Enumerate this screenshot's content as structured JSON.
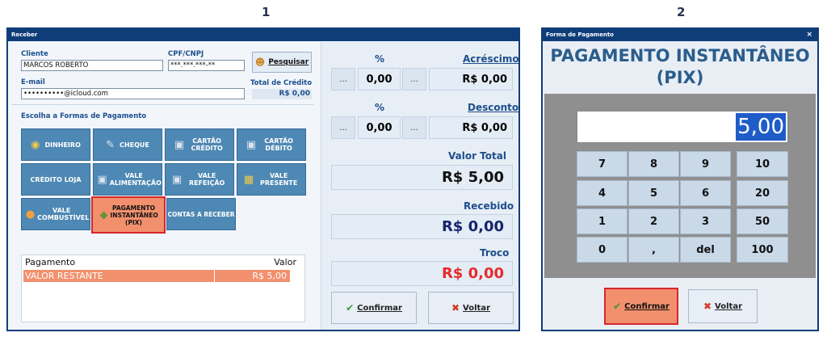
{
  "steps": {
    "first": "1",
    "second": "2"
  },
  "left_window": {
    "title": "Receber",
    "cliente_label": "Cliente",
    "cliente_value": "MARCOS ROBERTO",
    "cpf_label": "CPF/CNPJ",
    "cpf_value": "***.***.***-**",
    "pesquisar_label": "Pesquisar",
    "email_label": "E-mail",
    "email_value": "••••••••••@icloud.com",
    "total_credito_label": "Total de Crédito",
    "total_credito_value": "R$ 0,00",
    "formas_label": "Escolha a Formas de Pagamento",
    "payment_buttons": {
      "dinheiro": "DINHEIRO",
      "cheque": "CHEQUE",
      "cartao_credito": "CARTÃO CRÉDITO",
      "cartao_debito": "CARTÃO DÉBITO",
      "credito_loja": "CRÉDITO LOJA",
      "vale_alimentacao": "VALE ALIMENTAÇÃO",
      "vale_refeicao": "VALE REFEIÇÃO",
      "vale_presente": "VALE PRESENTE",
      "vale_combustivel": "VALE COMBUSTÍVEL",
      "pix": "PAGAMENTO INSTANTÂNEO (PIX)",
      "contas_receber": "CONTAS A RECEBER"
    },
    "table": {
      "col_pagamento": "Pagamento",
      "col_valor": "Valor",
      "rows": [
        {
          "pagamento": "VALOR RESTANTE",
          "valor": "R$ 5,00"
        }
      ]
    },
    "right_panel": {
      "pct_label_1": "%",
      "acrescimo_label": "Acréscimo",
      "ellipsis": "...",
      "acrescimo_pct": "0,00",
      "acrescimo_value": "R$ 0,00",
      "pct_label_2": "%",
      "desconto_label": "Desconto",
      "desconto_pct": "0,00",
      "desconto_value": "R$ 0,00",
      "valor_total_label": "Valor Total",
      "valor_total_value": "R$ 5,00",
      "recebido_label": "Recebido",
      "recebido_value": "R$ 0,00",
      "troco_label": "Troco",
      "troco_value": "R$ 0,00",
      "confirmar_label": "Confirmar",
      "voltar_label": "Voltar"
    }
  },
  "right_window": {
    "title": "Forma de Pagamento",
    "close": "×",
    "heading": "PAGAMENTO INSTANTÂNEO (PIX)",
    "amount": "5,00",
    "keys": {
      "k7": "7",
      "k8": "8",
      "k9": "9",
      "k10": "10",
      "k4": "4",
      "k5": "5",
      "k6": "6",
      "k20": "20",
      "k1": "1",
      "k2": "2",
      "k3": "3",
      "k50": "50",
      "k0": "0",
      "kcomma": ",",
      "kdel": "del",
      "k100": "100"
    },
    "confirmar_label": "Confirmar",
    "voltar_label": "Voltar"
  },
  "colors": {
    "title_bar": "#0f3d79",
    "button_blue": "#4e88b4",
    "highlight_orange": "#f2906d",
    "highlight_border": "#d6262c",
    "recebido_text": "#17246e",
    "troco_text": "#e62b2b"
  }
}
